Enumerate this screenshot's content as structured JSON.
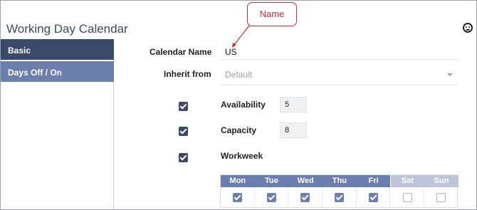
{
  "window": {
    "title": "Working Day Calendar",
    "status_icon": "smiley-icon"
  },
  "annotation": {
    "callout_text": "Name",
    "color": "#d62b2b"
  },
  "sidebar": {
    "items": [
      {
        "label": "Basic",
        "active": true
      },
      {
        "label": "Days Off / On",
        "active": false
      }
    ]
  },
  "form": {
    "calendar_name": {
      "label": "Calendar Name",
      "value": "US"
    },
    "inherit_from": {
      "label": "Inherit from",
      "value": "Default"
    },
    "availability": {
      "label": "Availability",
      "checked": true,
      "value": "5"
    },
    "capacity": {
      "label": "Capacity",
      "checked": true,
      "value": "8"
    },
    "workweek": {
      "label": "Workweek",
      "checked": true,
      "days": [
        {
          "label": "Mon",
          "checked": true
        },
        {
          "label": "Tue",
          "checked": true
        },
        {
          "label": "Wed",
          "checked": true
        },
        {
          "label": "Thu",
          "checked": true
        },
        {
          "label": "Fri",
          "checked": true
        },
        {
          "label": "Sat",
          "checked": false
        },
        {
          "label": "Sun",
          "checked": false
        }
      ]
    }
  },
  "colors": {
    "accent_dark": "#3b4a6b",
    "accent_light": "#6b7fae",
    "weekend": "#bcc6d6"
  }
}
